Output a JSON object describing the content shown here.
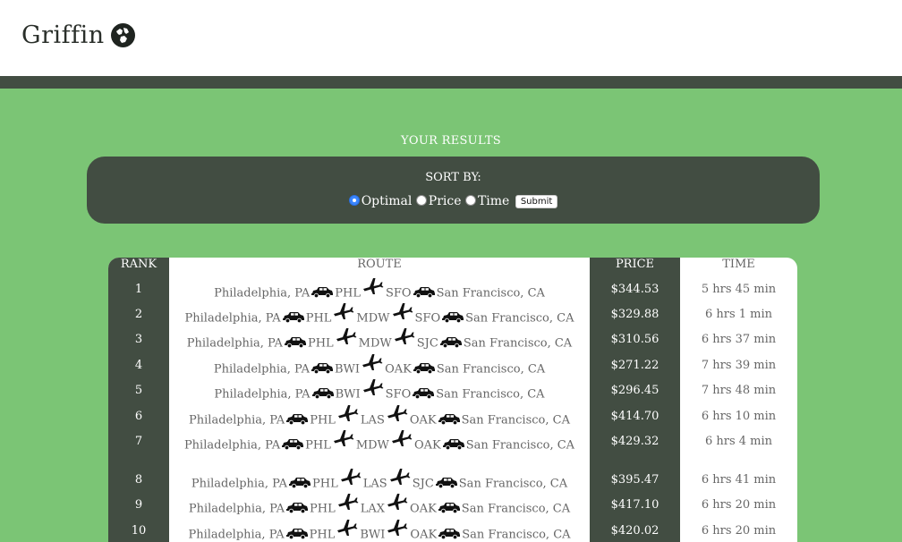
{
  "header": {
    "logo_text": "Griffin",
    "logo_icon": "globe-icon"
  },
  "results": {
    "title": "YOUR RESULTS",
    "sort": {
      "title": "SORT BY:",
      "options": [
        {
          "label": "Optimal",
          "checked": true
        },
        {
          "label": "Price",
          "checked": false
        },
        {
          "label": "Time",
          "checked": false
        }
      ],
      "submit_label": "Submit"
    }
  },
  "table": {
    "headers": {
      "rank": "RANK",
      "route": "ROUTE",
      "price": "PRICE",
      "time": "TIME"
    },
    "rows": [
      {
        "rank": "1",
        "route": [
          [
            "text",
            "Philadelphia, PA"
          ],
          [
            "car"
          ],
          [
            "text",
            "PHL"
          ],
          [
            "plane"
          ],
          [
            "text",
            "SFO"
          ],
          [
            "car"
          ],
          [
            "text",
            "San Francisco, CA"
          ]
        ],
        "price": "$344.53",
        "time": "5 hrs 45 min"
      },
      {
        "rank": "2",
        "route": [
          [
            "text",
            "Philadelphia, PA"
          ],
          [
            "car"
          ],
          [
            "text",
            "PHL"
          ],
          [
            "plane"
          ],
          [
            "text",
            "MDW"
          ],
          [
            "plane"
          ],
          [
            "text",
            "SFO"
          ],
          [
            "car"
          ],
          [
            "text",
            "San Francisco, CA"
          ]
        ],
        "price": "$329.88",
        "time": "6 hrs 1 min"
      },
      {
        "rank": "3",
        "route": [
          [
            "text",
            "Philadelphia, PA"
          ],
          [
            "car"
          ],
          [
            "text",
            "PHL"
          ],
          [
            "plane"
          ],
          [
            "text",
            "MDW"
          ],
          [
            "plane"
          ],
          [
            "text",
            "SJC"
          ],
          [
            "car"
          ],
          [
            "text",
            "San Francisco, CA"
          ]
        ],
        "price": "$310.56",
        "time": "6 hrs 37 min"
      },
      {
        "rank": "4",
        "route": [
          [
            "text",
            "Philadelphia, PA"
          ],
          [
            "car"
          ],
          [
            "text",
            "BWI"
          ],
          [
            "plane"
          ],
          [
            "text",
            "OAK"
          ],
          [
            "car"
          ],
          [
            "text",
            "San Francisco, CA"
          ]
        ],
        "price": "$271.22",
        "time": "7 hrs 39 min"
      },
      {
        "rank": "5",
        "route": [
          [
            "text",
            "Philadelphia, PA"
          ],
          [
            "car"
          ],
          [
            "text",
            "BWI"
          ],
          [
            "plane"
          ],
          [
            "text",
            "SFO"
          ],
          [
            "car"
          ],
          [
            "text",
            "San Francisco, CA"
          ]
        ],
        "price": "$296.45",
        "time": "7 hrs 48 min"
      },
      {
        "rank": "6",
        "route": [
          [
            "text",
            "Philadelphia, PA"
          ],
          [
            "car"
          ],
          [
            "text",
            "PHL"
          ],
          [
            "plane"
          ],
          [
            "text",
            "LAS"
          ],
          [
            "plane"
          ],
          [
            "text",
            "OAK"
          ],
          [
            "car"
          ],
          [
            "text",
            "San Francisco, CA"
          ]
        ],
        "price": "$414.70",
        "time": "6 hrs 10 min"
      },
      {
        "rank": "7",
        "route": [
          [
            "text",
            "Philadelphia, PA"
          ],
          [
            "car"
          ],
          [
            "text",
            "PHL"
          ],
          [
            "plane"
          ],
          [
            "text",
            "MDW"
          ],
          [
            "plane"
          ],
          [
            "text",
            "OAK"
          ],
          [
            "car"
          ],
          [
            "text",
            "San Francisco, CA"
          ]
        ],
        "price": "$429.32",
        "time": "6 hrs 4 min"
      },
      {
        "rank": "8",
        "route": [
          [
            "text",
            "Philadelphia, PA"
          ],
          [
            "car"
          ],
          [
            "text",
            "PHL"
          ],
          [
            "plane"
          ],
          [
            "text",
            "LAS"
          ],
          [
            "plane"
          ],
          [
            "text",
            "SJC"
          ],
          [
            "car"
          ],
          [
            "text",
            "San Francisco, CA"
          ]
        ],
        "price": "$395.47",
        "time": "6 hrs 41 min"
      },
      {
        "rank": "9",
        "route": [
          [
            "text",
            "Philadelphia, PA"
          ],
          [
            "car"
          ],
          [
            "text",
            "PHL"
          ],
          [
            "plane"
          ],
          [
            "text",
            "LAX"
          ],
          [
            "plane"
          ],
          [
            "text",
            "OAK"
          ],
          [
            "car"
          ],
          [
            "text",
            "San Francisco, CA"
          ]
        ],
        "price": "$417.10",
        "time": "6 hrs 20 min"
      },
      {
        "rank": "10",
        "route": [
          [
            "text",
            "Philadelphia, PA"
          ],
          [
            "car"
          ],
          [
            "text",
            "PHL"
          ],
          [
            "plane"
          ],
          [
            "text",
            "BWI"
          ],
          [
            "plane"
          ],
          [
            "text",
            "OAK"
          ],
          [
            "car"
          ],
          [
            "text",
            "San Francisco, CA"
          ]
        ],
        "price": "$420.02",
        "time": "6 hrs 20 min"
      }
    ]
  },
  "colors": {
    "accent_green": "#7bc575",
    "dark_panel": "#424d42"
  }
}
